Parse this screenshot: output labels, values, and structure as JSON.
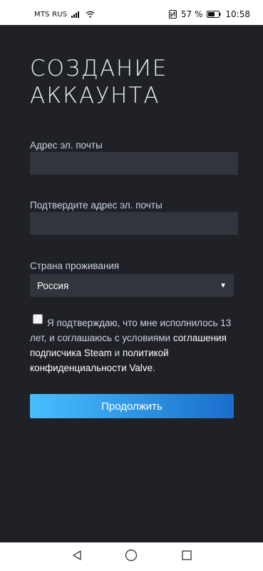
{
  "status_bar": {
    "carrier": "MTS RUS",
    "battery": "57 %",
    "time": "10:58",
    "icons": [
      "signal-icon",
      "wifi-icon",
      "nfc-icon",
      "battery-icon"
    ]
  },
  "page": {
    "title_line1": "СОЗДАНИЕ",
    "title_line2": "АККАУНТА"
  },
  "form": {
    "email_label": "Адрес эл. почты",
    "email_value": "",
    "confirm_email_label": "Подтвердите адрес эл. почты",
    "confirm_email_value": "",
    "country_label": "Страна проживания",
    "country_value": "Россия",
    "agreement": {
      "checked": false,
      "text_1": "Я подтверждаю, что мне исполнилось 13 лет, и соглашаюсь с условиями ",
      "link_subscriber": "соглашения подписчика Steam",
      "text_2": " и ",
      "link_privacy": "политикой конфиденциальности Valve",
      "text_3": "."
    },
    "continue_label": "Продолжить"
  },
  "nav_bar": {
    "icons": [
      "back-icon",
      "home-icon",
      "recents-icon"
    ]
  },
  "colors": {
    "background": "#1f2126",
    "field": "#32353c",
    "button_start": "#47bfff",
    "button_end": "#1a6dca"
  }
}
